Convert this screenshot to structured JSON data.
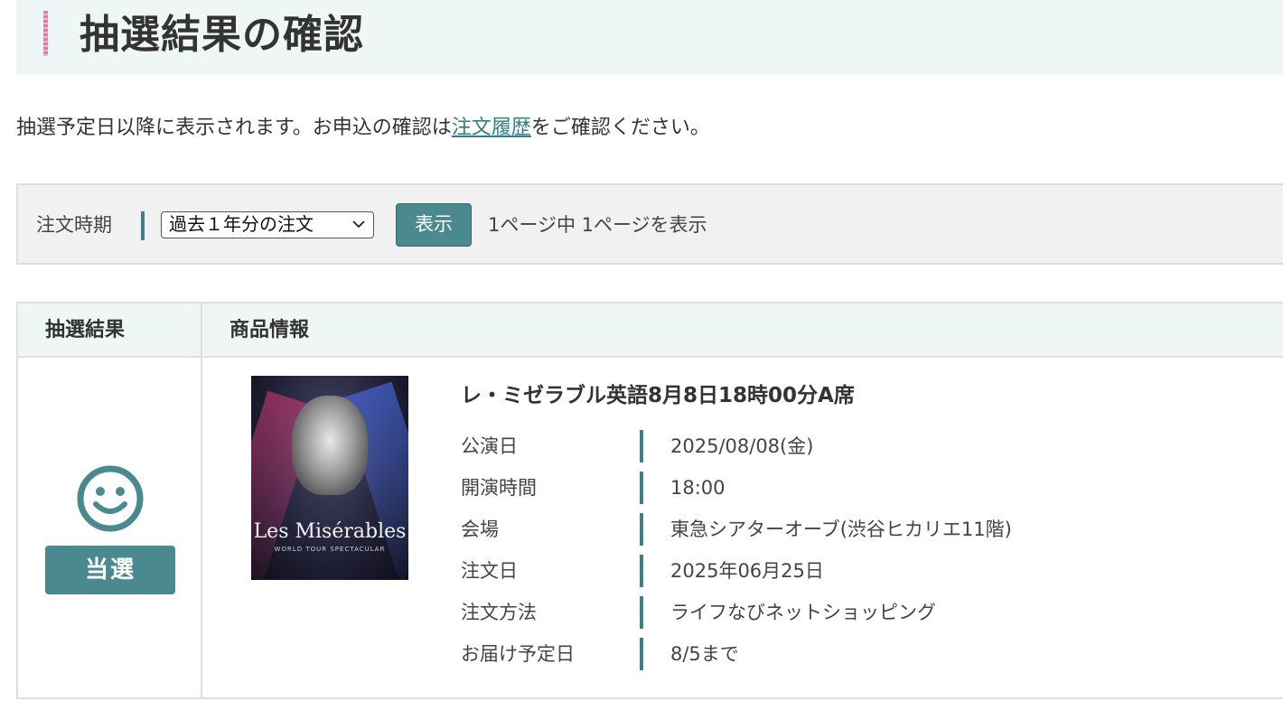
{
  "header": {
    "title": "抽選結果の確認"
  },
  "notice": {
    "before": "抽選予定日以降に表示されます。お申込の確認は",
    "link": "注文履歴",
    "after": "をご確認ください。"
  },
  "filter": {
    "label": "注文時期",
    "select_value": "過去１年分の注文",
    "button_label": "表示",
    "page_info": "1ページ中 1ページを表示"
  },
  "table": {
    "headers": [
      "抽選結果",
      "商品情報"
    ],
    "rows": [
      {
        "result_icon": "smiley-icon",
        "result_label": "当選",
        "poster": {
          "title_text": "Les Misérables",
          "subtitle_text": "WORLD TOUR SPECTACULAR"
        },
        "product_title": "レ・ミゼラブル英語8月8日18時00分A席",
        "details": [
          {
            "label": "公演日",
            "value": "2025/08/08(金)"
          },
          {
            "label": "開演時間",
            "value": "18:00"
          },
          {
            "label": "会場",
            "value": "東急シアターオーブ(渋谷ヒカリエ11階)"
          },
          {
            "label": "注文日",
            "value": "2025年06月25日"
          },
          {
            "label": "注文方法",
            "value": "ライフなびネットショッピング"
          },
          {
            "label": "お届け予定日",
            "value": "8/5まで"
          }
        ]
      }
    ]
  },
  "colors": {
    "accent": "#4a8a8f",
    "accent_dark": "#3f7f85",
    "title_accent": "#e27aa6",
    "header_bg": "#eff6f6",
    "link": "#2f7f84"
  }
}
